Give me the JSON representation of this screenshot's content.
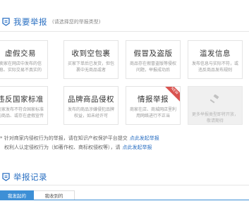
{
  "report_section": {
    "title": "我要举报",
    "subtitle": "(请选择您的举报类型)",
    "icon": "report-tag-icon"
  },
  "cards": [
    {
      "title": "虚假交易",
      "desc": "卖家在网店中发布的信息、实际交易不真实的"
    },
    {
      "title": "收到空包裹",
      "desc": "买家下单后已发货，但包裹中无商品或者"
    },
    {
      "title": "假冒及盗版",
      "desc": "商品存在假冒盗版等侵权问题，举报成功后"
    },
    {
      "title": "滥发信息",
      "desc": "发布信息与实际不符，或违反商品发布规则"
    },
    {
      "title": "违反国家标准",
      "desc": "卖家发布不符合国家标准的商品、或存在虚假宣传"
    },
    {
      "title": "品牌商品侵权",
      "desc": "发布的商品涉嫌侵犯品牌权益，如未经许可"
    },
    {
      "title": "情报举报",
      "desc": "商家在店、商城网店里利用网络进行不正当",
      "badge": "NEW"
    },
    {
      "title": "",
      "desc": "更多举报类型即将开放，敬请期待",
      "disabled": true,
      "icon": "gavel-icon"
    }
  ],
  "notes": {
    "line1": "* 针对商家内侵权行为的举报，请在知识产权保护平台提交",
    "link1": "点此发起举报",
    "line2": "权利人认定侵权行为（如著作权、商标权侵权等），请",
    "link2": "点此发起举报"
  },
  "records_section": {
    "title": "举报记录",
    "icon": "report-tag-icon"
  },
  "tabs": [
    {
      "label": "我发起的"
    },
    {
      "label": "我收到的"
    }
  ]
}
